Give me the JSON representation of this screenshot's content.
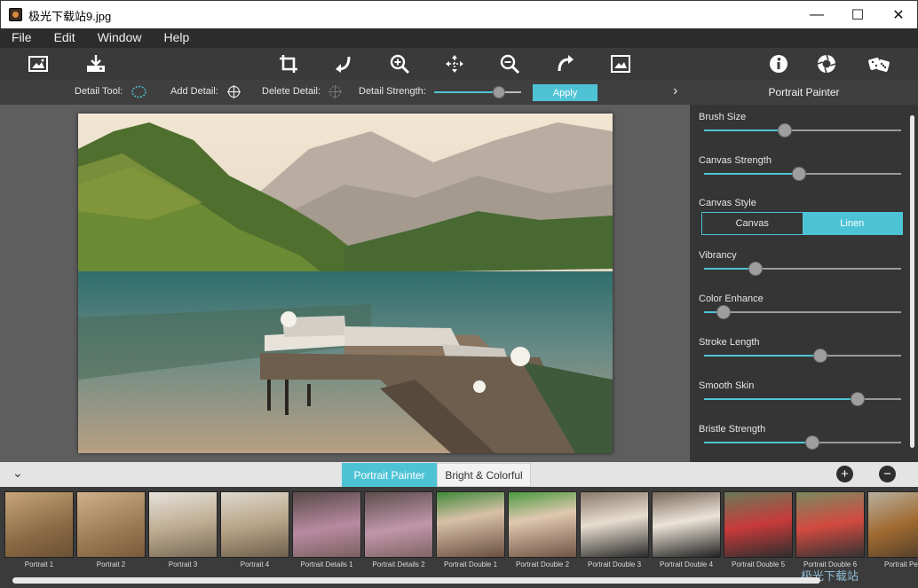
{
  "window": {
    "title": "极光下载站9.jpg",
    "minimize_icon": "—",
    "maximize_icon": "☐",
    "close_icon": "✕"
  },
  "menu": [
    "File",
    "Edit",
    "Window",
    "Help"
  ],
  "toolbar": {
    "left": [
      "open-image",
      "save-image"
    ],
    "center": [
      "crop",
      "rotate-left",
      "zoom-in",
      "move",
      "zoom-out",
      "rotate-right",
      "fit-image"
    ],
    "right": [
      "info",
      "settings",
      "random-dice"
    ]
  },
  "detail_bar": {
    "detail_tool_label": "Detail Tool:",
    "add_detail_label": "Add Detail:",
    "delete_detail_label": "Delete Detail:",
    "detail_strength_label": "Detail Strength:",
    "detail_strength_value": 0.74,
    "apply_label": "Apply",
    "collapse_arrow": "›"
  },
  "panel": {
    "title": "Portrait Painter",
    "sliders": [
      {
        "label": "Brush Size",
        "value": 0.41
      },
      {
        "label": "Canvas Strength",
        "value": 0.48
      },
      {
        "label": "Vibrancy",
        "value": 0.26
      },
      {
        "label": "Color Enhance",
        "value": 0.1
      },
      {
        "label": "Stroke Length",
        "value": 0.59
      },
      {
        "label": "Smooth Skin",
        "value": 0.78
      },
      {
        "label": "Bristle Strength",
        "value": 0.55
      }
    ],
    "canvas_style_label": "Canvas Style",
    "canvas_style_options": [
      "Canvas",
      "Linen"
    ],
    "canvas_style_selected": "Linen"
  },
  "presets": {
    "collapse_icon": "⌄",
    "tabs": [
      "Portrait Painter",
      "Bright & Colorful"
    ],
    "active_tab": "Portrait Painter",
    "add_icon": "+",
    "remove_icon": "−",
    "thumbnails": [
      "Portrait 1",
      "Portrait 2",
      "Portrait 3",
      "Portrait 4",
      "Portrait Details 1",
      "Portrait Details 2",
      "Portrait Double 1",
      "Portrait Double 2",
      "Portrait Double 3",
      "Portrait Double 4",
      "Portrait Double 5",
      "Portrait Double 6",
      "Portrait Pet"
    ],
    "watermark": "极光下载站"
  },
  "colors": {
    "accent": "#4fc3d6",
    "panel": "#353535",
    "toolbar": "#3a3a3a",
    "canvas_bg": "#5e5e5e"
  }
}
